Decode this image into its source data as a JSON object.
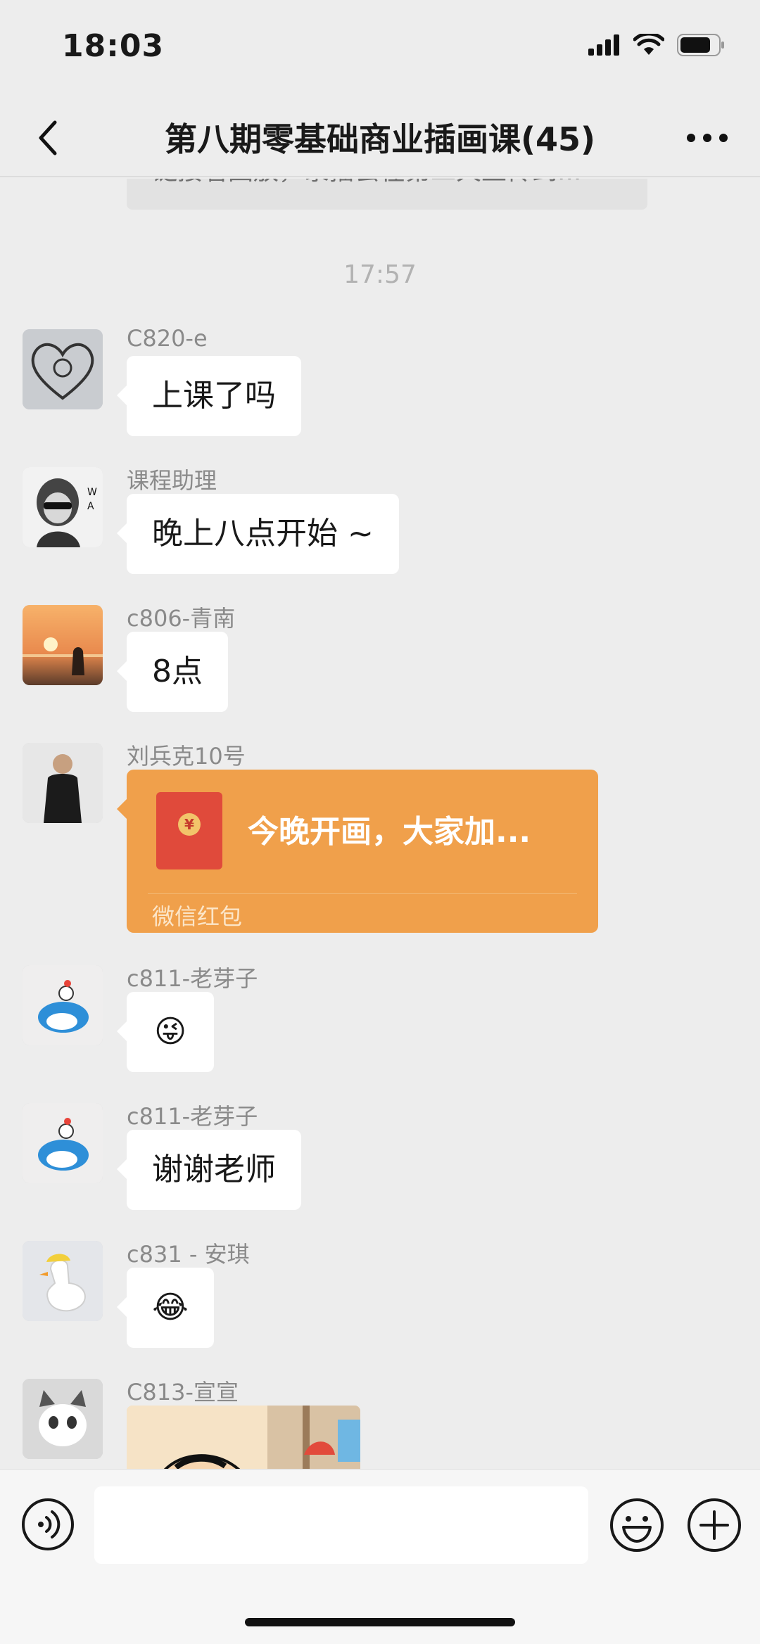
{
  "status_bar": {
    "time": "18:03"
  },
  "header": {
    "title": "第八期零基础商业插画课(45)"
  },
  "prev_message": {
    "text": "链接看回放，录播会在第二天上传到..."
  },
  "timestamp": "17:57",
  "messages": [
    {
      "sender": "C820-e",
      "text": "上课了吗",
      "avatar": "heart-sketch"
    },
    {
      "sender": "课程助理",
      "text": "晚上八点开始 ~",
      "avatar": "girl-sunglasses"
    },
    {
      "sender": "c806-青南",
      "text": "8点",
      "avatar": "sunset-beach"
    },
    {
      "sender": "刘兵克10号",
      "avatar": "man-black-coat",
      "red_packet": {
        "title": "今晚开画，大家加...",
        "label": "微信红包",
        "color": "#f0a04b"
      }
    },
    {
      "sender": "c811-老芽子",
      "emoji": "😜",
      "avatar": "doraemon"
    },
    {
      "sender": "c811-老芽子",
      "text": "谢谢老师",
      "avatar": "doraemon"
    },
    {
      "sender": "c831 - 安琪",
      "emoji": "😂",
      "avatar": "duck-hat"
    },
    {
      "sender": "C813-宣宣",
      "avatar": "cat-with-hat",
      "image": "cartoon-sticker"
    }
  ],
  "input_bar": {
    "placeholder": ""
  }
}
